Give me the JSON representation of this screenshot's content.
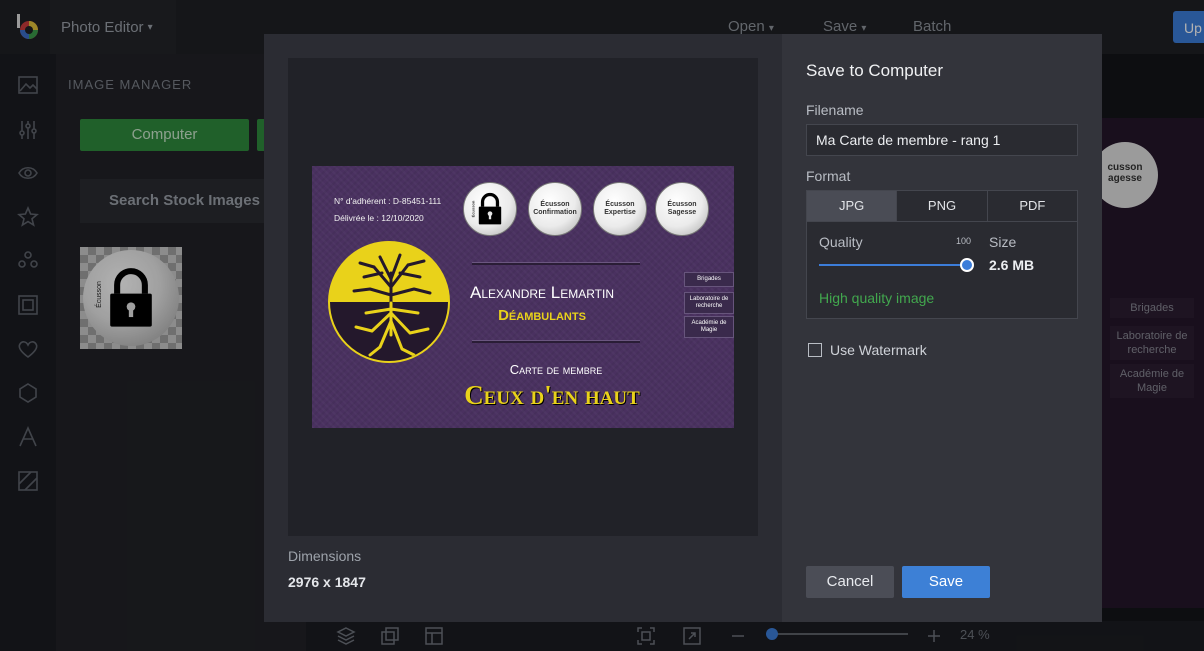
{
  "app": {
    "title": "Photo Editor",
    "menu": [
      "Open",
      "Save",
      "Batch"
    ],
    "upload_label": "Up"
  },
  "panel": {
    "title": "IMAGE MANAGER",
    "computer_button": "Computer",
    "search_stock": "Search Stock Images"
  },
  "bottom": {
    "zoom": "24 %"
  },
  "right_peek": {
    "badge": "cusson\nagesse",
    "tags": [
      "Brigades",
      "Laboratoire de recherche",
      "Académie de Magie"
    ]
  },
  "preview": {
    "dimensions_label": "Dimensions",
    "dimensions_value": "2976 x 1847",
    "card": {
      "member_number": "N° d'adhérent : D-85451-111",
      "issued": "Délivrée le : 12/10/2020",
      "badges": [
        "Écusson Confirmation",
        "Écusson Expertise",
        "Écusson Sagesse"
      ],
      "locked_badge_label": "Écusson",
      "name": "Alexandre Lemartin",
      "group": "Déambulants",
      "subtitle": "Carte de membre",
      "org": "Ceux d'en haut",
      "tags": [
        "Brigades",
        "Laboratoire de recherche",
        "Académie de Magie"
      ]
    },
    "thumb_label": "Écusson"
  },
  "form": {
    "title": "Save to Computer",
    "filename_label": "Filename",
    "filename_value": "Ma Carte de membre - rang 1",
    "format_label": "Format",
    "formats": [
      "JPG",
      "PNG",
      "PDF"
    ],
    "selected_format": "JPG",
    "quality_label": "Quality",
    "quality_value": "100",
    "quality_fraction": 1.0,
    "size_label": "Size",
    "size_value": "2.6 MB",
    "quality_note": "High quality image",
    "watermark_label": "Use Watermark",
    "watermark_checked": false,
    "cancel_label": "Cancel",
    "save_label": "Save"
  },
  "colors": {
    "accent": "#3c7dd9",
    "green": "#2f8a3d",
    "quality_note": "#42a84e",
    "card_purple": "#4a3160",
    "card_yellow": "#e9d21a"
  }
}
